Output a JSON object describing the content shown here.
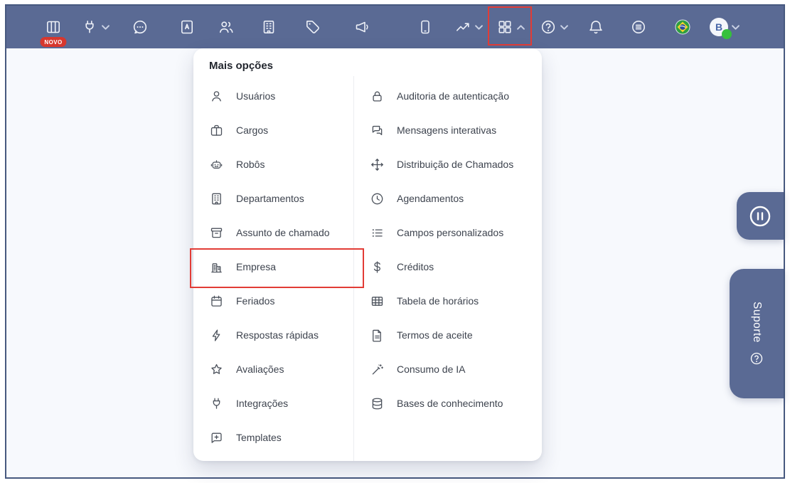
{
  "colors": {
    "nav_background": "#5a6a94",
    "annotation_red": "#e23c36",
    "badge_red": "#d6372e",
    "panel_background": "#ffffff",
    "page_background": "#f7f9fd",
    "menu_text": "#3d434e",
    "status_green": "#35c03c"
  },
  "nav": {
    "novo_badge": "NOVO",
    "icons": [
      "kanban-columns-icon",
      "plug-icon",
      "chat-bubble-icon",
      "contacts-book-icon",
      "users-icon",
      "building-icon",
      "tag-icon",
      "megaphone-icon",
      "phone-icon",
      "trending-up-icon",
      "apps-grid-icon",
      "help-icon",
      "bell-icon",
      "queue-circle-icon",
      "brazil-flag-icon",
      "avatar"
    ]
  },
  "user": {
    "initial": "B"
  },
  "menu": {
    "title": "Mais opções",
    "left": [
      {
        "label": "Usuários",
        "icon": "user-icon"
      },
      {
        "label": "Cargos",
        "icon": "briefcase-icon"
      },
      {
        "label": "Robôs",
        "icon": "robot-icon"
      },
      {
        "label": "Departamentos",
        "icon": "department-building-icon"
      },
      {
        "label": "Assunto de chamado",
        "icon": "archive-box-icon"
      },
      {
        "label": "Empresa",
        "icon": "office-building-icon",
        "highlighted": true
      },
      {
        "label": "Feriados",
        "icon": "calendar-icon"
      },
      {
        "label": "Respostas rápidas",
        "icon": "lightning-icon"
      },
      {
        "label": "Avaliações",
        "icon": "star-icon"
      },
      {
        "label": "Integrações",
        "icon": "plug-icon"
      },
      {
        "label": "Templates",
        "icon": "message-plus-icon"
      }
    ],
    "right": [
      {
        "label": "Auditoria de autenticação",
        "icon": "lock-icon"
      },
      {
        "label": "Mensagens interativas",
        "icon": "chat-bubbles-icon"
      },
      {
        "label": "Distribuição de Chamados",
        "icon": "move-arrows-icon"
      },
      {
        "label": "Agendamentos",
        "icon": "clock-icon"
      },
      {
        "label": "Campos personalizados",
        "icon": "list-icon"
      },
      {
        "label": "Créditos",
        "icon": "dollar-icon"
      },
      {
        "label": "Tabela de horários",
        "icon": "table-icon"
      },
      {
        "label": "Termos de aceite",
        "icon": "document-icon"
      },
      {
        "label": "Consumo de IA",
        "icon": "magic-wand-icon"
      },
      {
        "label": "Bases de conhecimento",
        "icon": "database-icon"
      }
    ]
  },
  "right_rail": {
    "suporte_label": "Suporte"
  }
}
